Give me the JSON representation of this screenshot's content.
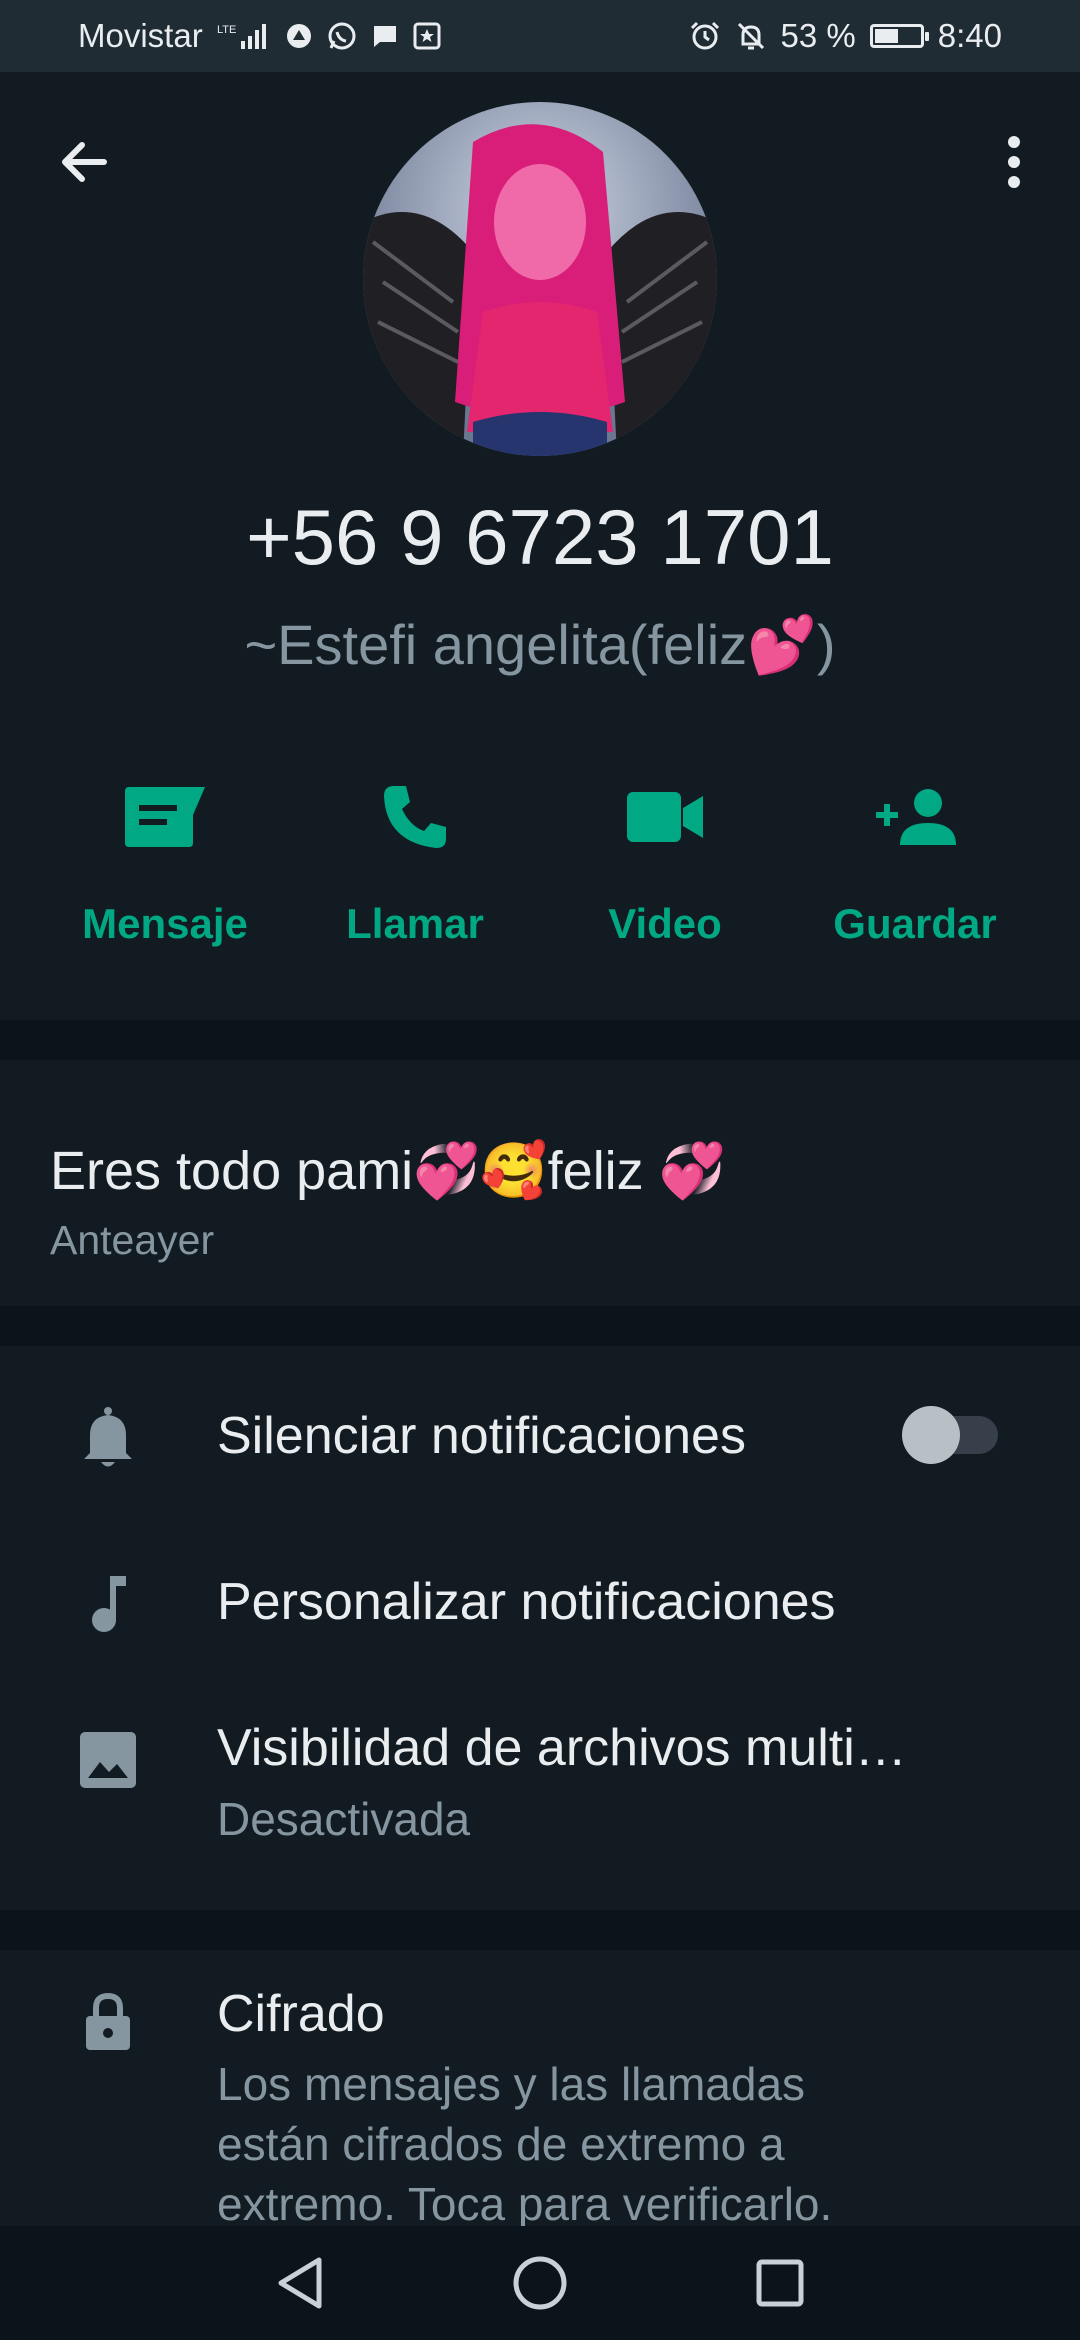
{
  "status_bar": {
    "carrier": "Movistar",
    "network": "LTE",
    "battery_percent": "53 %",
    "battery_level": 0.53,
    "time": "8:40"
  },
  "profile": {
    "phone": "+56 9 6723 1701",
    "push_name": "~Estefi angelita(feliz💕)"
  },
  "actions": [
    {
      "label": "Mensaje",
      "icon": "message-icon"
    },
    {
      "label": "Llamar",
      "icon": "phone-icon"
    },
    {
      "label": "Video",
      "icon": "video-icon"
    },
    {
      "label": "Guardar",
      "icon": "add-contact-icon"
    }
  ],
  "about": {
    "text": "Eres todo pami💞🥰feliz 💞",
    "date": "Anteayer"
  },
  "settings": {
    "mute_label": "Silenciar notificaciones",
    "mute_enabled": false,
    "custom_label": "Personalizar notificaciones",
    "media_label": "Visibilidad de archivos multi…",
    "media_sub": "Desactivada"
  },
  "encryption": {
    "title": "Cifrado",
    "description": "Los mensajes y las llamadas están cifrados de extremo a extremo. Toca para verificarlo."
  },
  "colors": {
    "accent": "#00a884",
    "background": "#0b141a",
    "panel": "#111b21",
    "muted_text": "#8696a0"
  }
}
